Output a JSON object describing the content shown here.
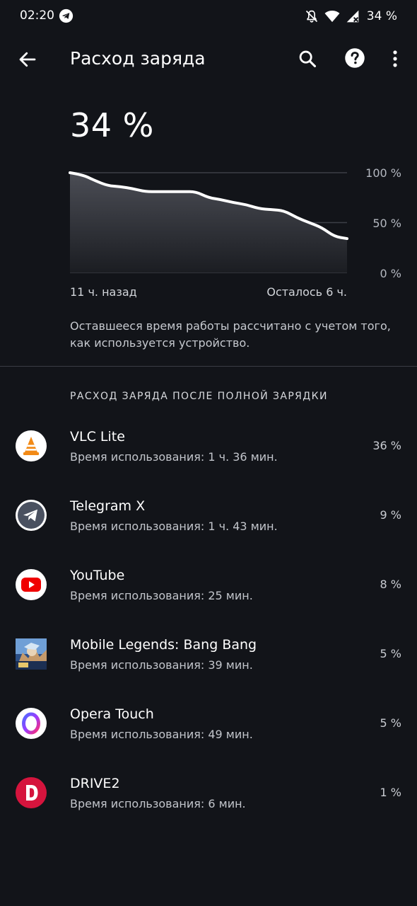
{
  "status_bar": {
    "time": "02:20",
    "battery": "34 %",
    "icons": [
      "telegram-icon",
      "silent-bell-icon",
      "wifi-icon",
      "cellular-signal-icon"
    ]
  },
  "app_bar": {
    "title": "Расход заряда",
    "icons": [
      "back-arrow-icon",
      "search-icon",
      "help-icon",
      "more-vert-icon"
    ]
  },
  "battery_level": "34 %",
  "chart_data": {
    "type": "area",
    "y_ticks": [
      "100 %",
      "50 %",
      "0 %"
    ],
    "ylim": [
      0,
      100
    ],
    "x_labels": [
      "11 ч. назад",
      "Осталось 6 ч."
    ],
    "x": [
      0,
      0.5,
      1,
      1.5,
      2,
      2.5,
      3,
      3.5,
      4,
      4.5,
      5,
      5.5,
      6,
      6.5,
      7,
      7.5,
      8,
      8.5,
      9,
      9.5,
      10,
      10.5,
      11
    ],
    "values": [
      100,
      98,
      92,
      87,
      86,
      84,
      81,
      81,
      81,
      81,
      81,
      75,
      73,
      70,
      68,
      64,
      63,
      62,
      55,
      50,
      45,
      36,
      34
    ],
    "grid": true,
    "colors": {
      "line": "#ffffff",
      "fill_top": "#4b4d55",
      "fill_bottom": "#1b1d22",
      "grid": "#3c3f47"
    }
  },
  "info_text": "Оставшееся время работы рассчитано с учетом того, как используется устройство.",
  "section_header": "РАСХОД ЗАРЯДА ПОСЛЕ ПОЛНОЙ ЗАРЯДКИ",
  "apps": [
    {
      "name": "VLC Lite",
      "usage": "Время использования: 1 ч. 36 мин.",
      "percent": "36 %",
      "icon": "vlc-icon"
    },
    {
      "name": "Telegram X",
      "usage": "Время использования: 1 ч. 43 мин.",
      "percent": "9 %",
      "icon": "telegram-x-icon"
    },
    {
      "name": "YouTube",
      "usage": "Время использования: 25 мин.",
      "percent": "8 %",
      "icon": "youtube-icon"
    },
    {
      "name": "Mobile Legends: Bang Bang",
      "usage": "Время использования: 39 мин.",
      "percent": "5 %",
      "icon": "mobile-legends-icon"
    },
    {
      "name": "Opera Touch",
      "usage": "Время использования: 49 мин.",
      "percent": "5 %",
      "icon": "opera-touch-icon"
    },
    {
      "name": "DRIVE2",
      "usage": "Время использования: 6 мин.",
      "percent": "1 %",
      "icon": "drive2-icon"
    }
  ]
}
